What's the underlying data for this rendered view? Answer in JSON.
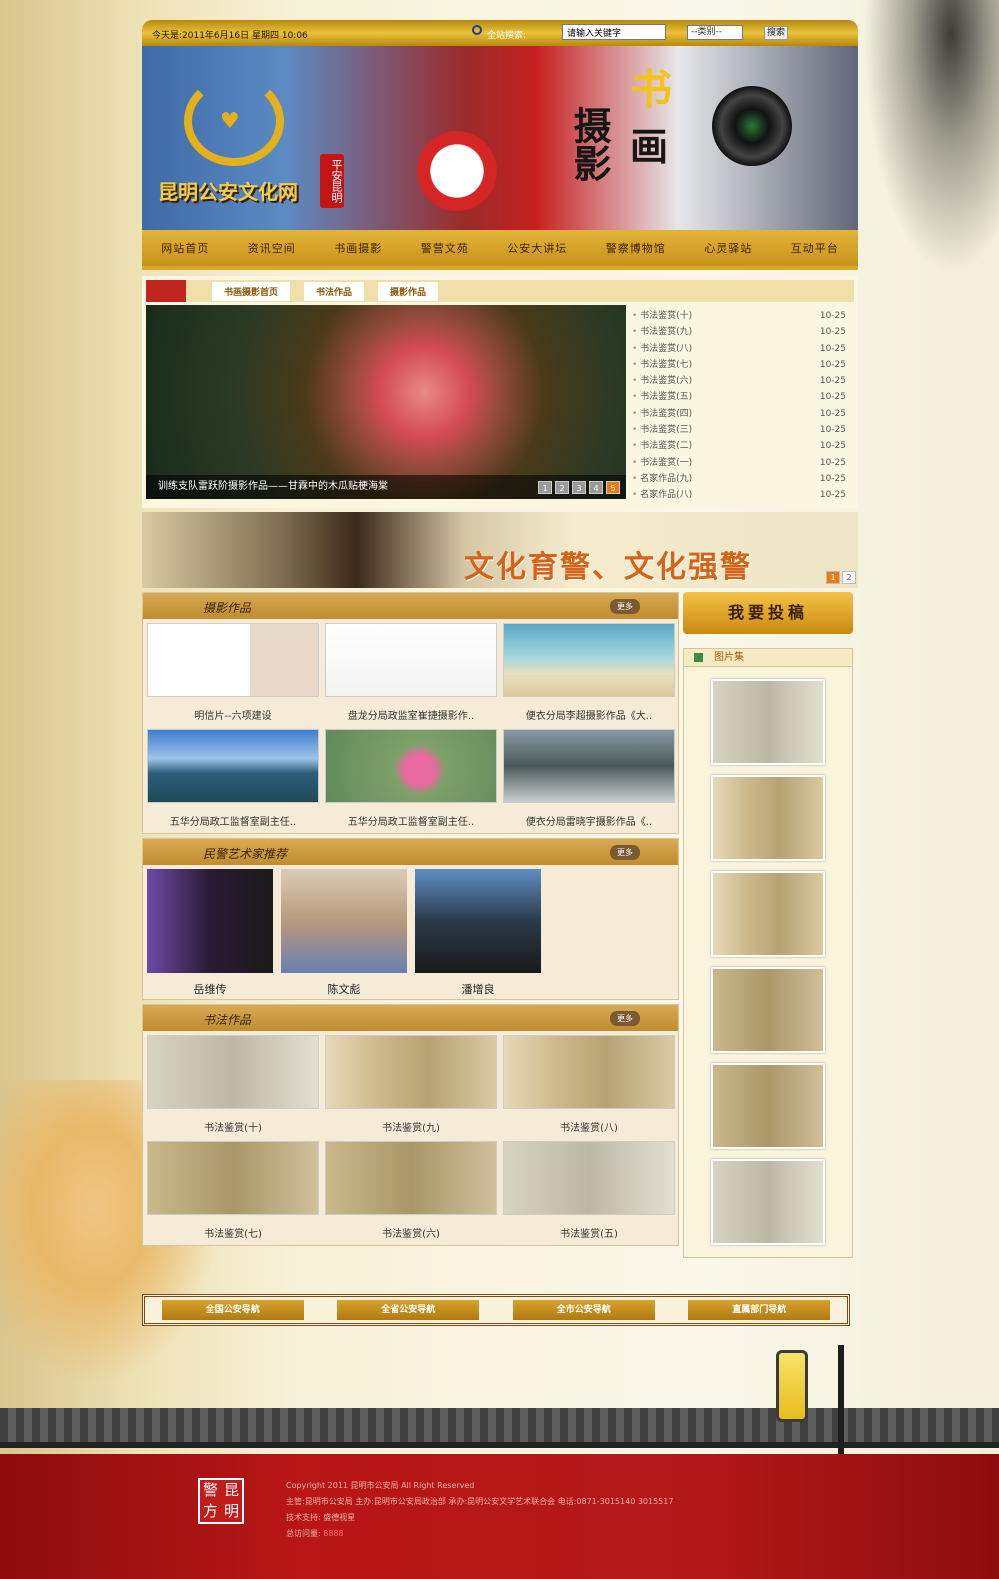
{
  "topbar": {
    "date": "今天是:2011年6月16日 星期四 10:06",
    "search_label": "全站搜索:",
    "search_placeholder": "请输入关键字",
    "category": "--类别--",
    "search_button": "搜索"
  },
  "banner": {
    "site_name": "昆明公安文化网",
    "seal": "平安昆明",
    "title_1": "书",
    "title_2": "摄",
    "title_3": "画",
    "title_4": "影"
  },
  "nav": [
    "网站首页",
    "资讯空间",
    "书画摄影",
    "警营文苑",
    "公安大讲坛",
    "警察博物馆",
    "心灵驿站",
    "互动平台"
  ],
  "tabs": [
    "书画摄影首页",
    "书法作品",
    "摄影作品"
  ],
  "slide": {
    "caption": "训练支队雷跃阶摄影作品——甘霖中的木瓜贴梗海棠",
    "pages": [
      "1",
      "2",
      "3",
      "4",
      "5"
    ],
    "active": "5"
  },
  "news": [
    {
      "title": "书法鉴赏(十)",
      "date": "10-25"
    },
    {
      "title": "书法鉴赏(九)",
      "date": "10-25"
    },
    {
      "title": "书法鉴赏(八)",
      "date": "10-25"
    },
    {
      "title": "书法鉴赏(七)",
      "date": "10-25"
    },
    {
      "title": "书法鉴赏(六)",
      "date": "10-25"
    },
    {
      "title": "书法鉴赏(五)",
      "date": "10-25"
    },
    {
      "title": "书法鉴赏(四)",
      "date": "10-25"
    },
    {
      "title": "书法鉴赏(三)",
      "date": "10-25"
    },
    {
      "title": "书法鉴赏(二)",
      "date": "10-25"
    },
    {
      "title": "书法鉴赏(一)",
      "date": "10-25"
    },
    {
      "title": "名家作品(九)",
      "date": "10-25"
    },
    {
      "title": "名家作品(八)",
      "date": "10-25"
    }
  ],
  "promo": {
    "text": "文化育警、文化强警",
    "pages": [
      "1",
      "2"
    ]
  },
  "photo_panel": {
    "title": "摄影作品",
    "more": "更多",
    "items": [
      "明信片--六项建设",
      "盘龙分局政监室崔捷摄影作..",
      "便衣分局李超摄影作品《大..",
      "五华分局政工监督室副主任..",
      "五华分局政工监督室副主任..",
      "便衣分局雷晓宇摄影作品《.."
    ]
  },
  "artist_panel": {
    "title": "民警艺术家推荐",
    "more": "更多",
    "people": [
      "岳维传",
      "陈文彪",
      "潘增良"
    ]
  },
  "calligraphy_panel": {
    "title": "书法作品",
    "more": "更多",
    "items": [
      "书法鉴赏(十)",
      "书法鉴赏(九)",
      "书法鉴赏(八)",
      "书法鉴赏(七)",
      "书法鉴赏(六)",
      "书法鉴赏(五)"
    ]
  },
  "sidebar": {
    "submit": "我要投稿",
    "gallery_title": "图片集"
  },
  "footnav": [
    "全国公安导航",
    "全省公安导航",
    "全市公安导航",
    "直属部门导航"
  ],
  "footer": {
    "logo": [
      "昆",
      "警",
      "明",
      "方"
    ],
    "copyright": "Copyright 2011 昆明市公安局 All Right Reserved",
    "line2": "主管:昆明市公安局    主办:昆明市公安局政治部    承办:昆明公安文学艺术联合会    电话:0871-3015140 3015517",
    "line3": "技术支持: 盛德视星",
    "visits_label": "总访问量:",
    "visits": "8888"
  }
}
